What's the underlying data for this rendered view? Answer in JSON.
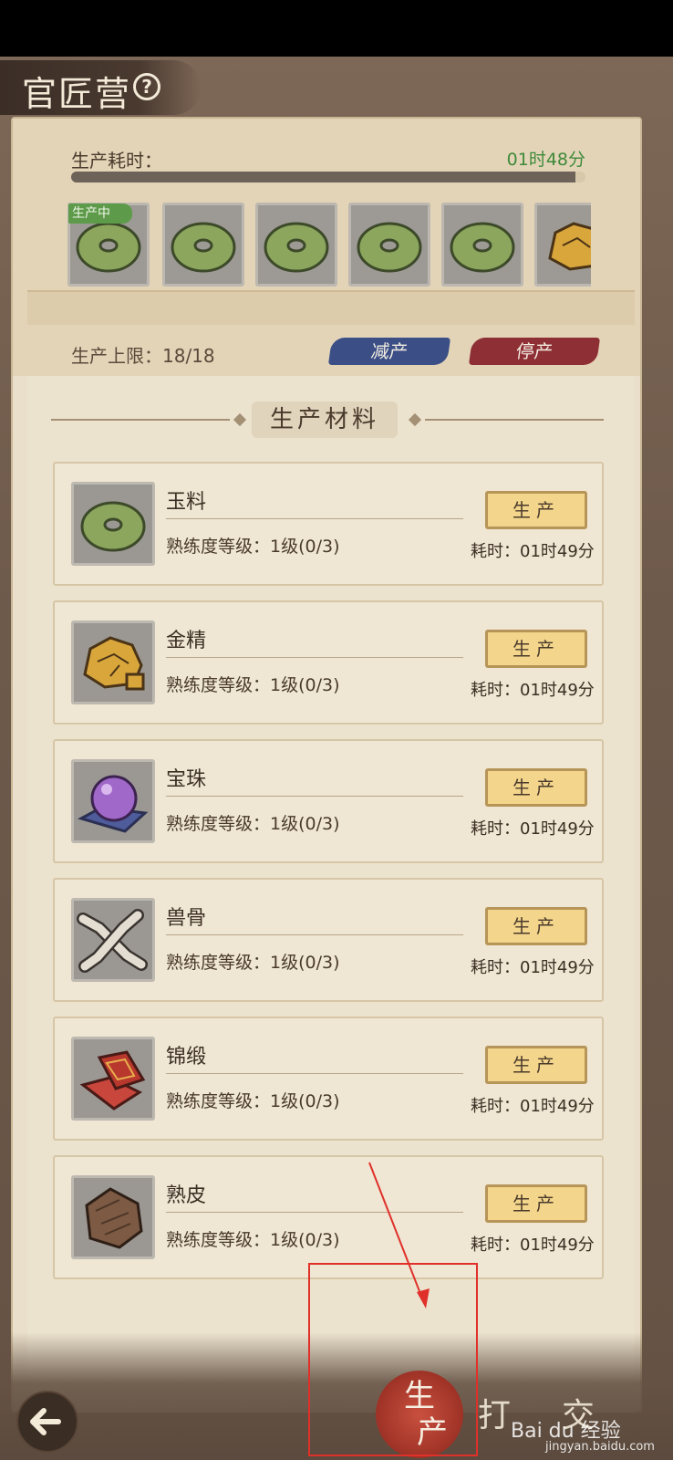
{
  "header": {
    "title": "官匠营",
    "help_icon": "question-circle-icon"
  },
  "production": {
    "time_label": "生产耗时：",
    "time_value": "01时48分",
    "progress_fraction": 0.02,
    "queue": [
      {
        "item": "jade-disc-icon",
        "status": "生产中"
      },
      {
        "item": "jade-disc-icon"
      },
      {
        "item": "jade-disc-icon"
      },
      {
        "item": "jade-disc-icon"
      },
      {
        "item": "jade-disc-icon"
      },
      {
        "item": "gold-ore-icon"
      }
    ],
    "limit_label": "生产上限：18/18",
    "reduce_label": "减产",
    "stop_label": "停产"
  },
  "materials": {
    "section_title": "生产材料",
    "produce_label": "生产",
    "items": [
      {
        "name": "玉料",
        "proficiency": "熟练度等级：1级(0/3)",
        "cost": "耗时：01时49分",
        "icon": "jade-disc-icon"
      },
      {
        "name": "金精",
        "proficiency": "熟练度等级：1级(0/3)",
        "cost": "耗时：01时49分",
        "icon": "gold-ore-icon"
      },
      {
        "name": "宝珠",
        "proficiency": "熟练度等级：1级(0/3)",
        "cost": "耗时：01时49分",
        "icon": "pearl-icon"
      },
      {
        "name": "兽骨",
        "proficiency": "熟练度等级：1级(0/3)",
        "cost": "耗时：01时49分",
        "icon": "bone-icon"
      },
      {
        "name": "锦缎",
        "proficiency": "熟练度等级：1级(0/3)",
        "cost": "耗时：01时49分",
        "icon": "brocade-icon"
      },
      {
        "name": "熟皮",
        "proficiency": "熟练度等级：1级(0/3)",
        "cost": "耗时：01时49分",
        "icon": "leather-icon"
      }
    ]
  },
  "bottom_nav": {
    "back_icon": "arrow-left-icon",
    "tabs": [
      {
        "label_top": "生",
        "label_bottom": "产",
        "active": true
      },
      {
        "label": "打"
      },
      {
        "label": "交"
      }
    ]
  },
  "watermark": {
    "brand": "Bai du 经验",
    "url": "jingyan.baidu.com"
  },
  "colors": {
    "accent_green": "#3f8a3a",
    "reduce_blue": "#3b4f86",
    "stop_red": "#8e2f35",
    "produce_gold": "#f3d58b",
    "annotation_red": "#e0302a"
  }
}
